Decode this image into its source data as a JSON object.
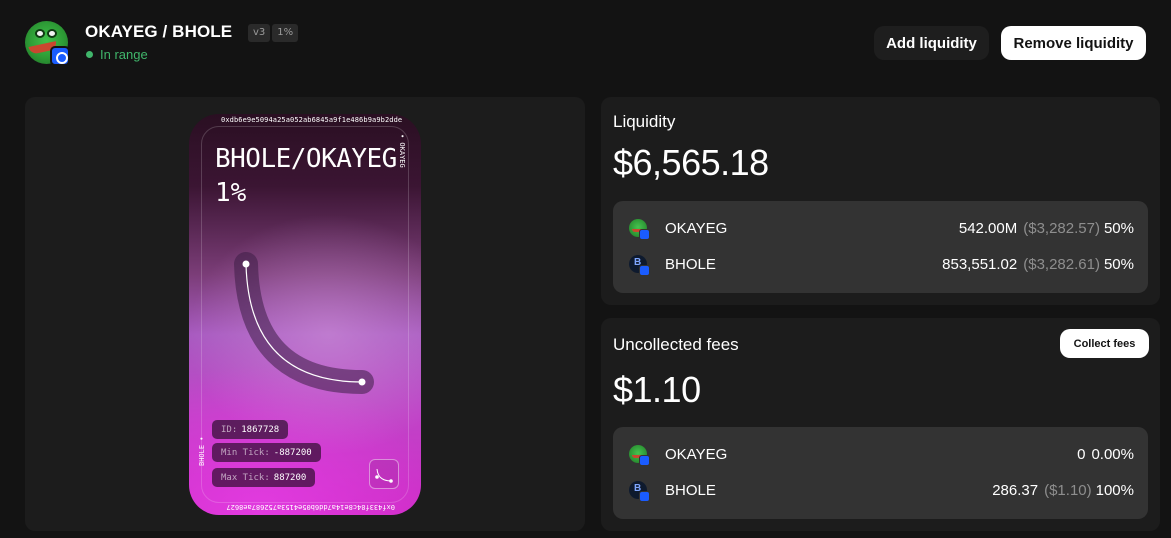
{
  "header": {
    "pair": "OKAYEG / BHOLE",
    "version_tag": "v3",
    "fee_tag": "1%",
    "status": "In range",
    "add_label": "Add liquidity",
    "remove_label": "Remove liquidity"
  },
  "nft": {
    "top_address": "0xdb6e9e5094a25a052ab6845a9f1e486b9a9b2dde",
    "right_symbol": "• OKAYEG",
    "pair": "BHOLE/OKAYEG",
    "fee": "1%",
    "left_symbol": "BHOLE •",
    "bottom_address": "0xf433f84c8e14a7dd6b05e4153a752687ae8627",
    "chips": [
      {
        "key": "ID:",
        "value": "1867728"
      },
      {
        "key": "Min Tick:",
        "value": "-887200"
      },
      {
        "key": "Max Tick:",
        "value": "887200"
      }
    ]
  },
  "liquidity": {
    "title": "Liquidity",
    "value": "$6,565.18",
    "tokens": [
      {
        "symbol": "OKAYEG",
        "icon": "okayeg-frog-icon",
        "amount": "542.00M",
        "usd": "($3,282.57)",
        "pct": "50%"
      },
      {
        "symbol": "BHOLE",
        "icon": "bhole-token-icon",
        "amount": "853,551.02",
        "usd": "($3,282.61)",
        "pct": "50%"
      }
    ]
  },
  "fees": {
    "title": "Uncollected fees",
    "value": "$1.10",
    "collect_label": "Collect fees",
    "tokens": [
      {
        "symbol": "OKAYEG",
        "icon": "okayeg-frog-icon",
        "amount": "0",
        "usd": "",
        "pct": "0.00%"
      },
      {
        "symbol": "BHOLE",
        "icon": "bhole-token-icon",
        "amount": "286.37",
        "usd": "($1.10)",
        "pct": "100%"
      }
    ]
  },
  "colors": {
    "background": "#131313",
    "panel": "#1c1c1c",
    "inner": "#333333",
    "in_range": "#40b66b",
    "chain_badge": "#1a5cff",
    "nft_magenta": "#d02cc8"
  }
}
